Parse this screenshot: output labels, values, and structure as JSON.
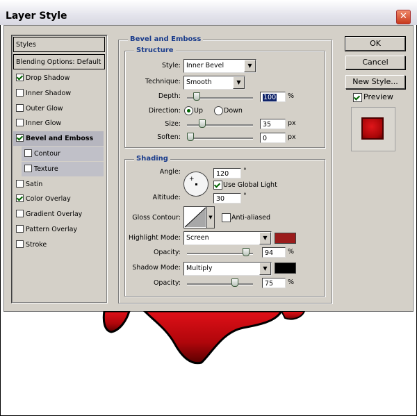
{
  "window": {
    "title": "Layer Style",
    "close_glyph": "✕"
  },
  "styles_list": {
    "header": "Styles",
    "blending": "Blending Options: Default",
    "items": [
      {
        "label": "Drop Shadow",
        "checked": true
      },
      {
        "label": "Inner Shadow",
        "checked": false
      },
      {
        "label": "Outer Glow",
        "checked": false
      },
      {
        "label": "Inner Glow",
        "checked": false
      },
      {
        "label": "Bevel and Emboss",
        "checked": true,
        "active": true
      },
      {
        "label": "Contour",
        "checked": false,
        "sub": true
      },
      {
        "label": "Texture",
        "checked": false,
        "sub": true
      },
      {
        "label": "Satin",
        "checked": false
      },
      {
        "label": "Color Overlay",
        "checked": true
      },
      {
        "label": "Gradient Overlay",
        "checked": false
      },
      {
        "label": "Pattern Overlay",
        "checked": false
      },
      {
        "label": "Stroke",
        "checked": false
      }
    ]
  },
  "bevel": {
    "title": "Bevel and Emboss",
    "structure": {
      "title": "Structure",
      "style_label": "Style:",
      "style_value": "Inner Bevel",
      "technique_label": "Technique:",
      "technique_value": "Smooth",
      "depth_label": "Depth:",
      "depth_value": "100",
      "depth_unit": "%",
      "depth_slider": 0.1,
      "direction_label": "Direction:",
      "direction_up": "Up",
      "direction_down": "Down",
      "direction_selected": "Up",
      "size_label": "Size:",
      "size_value": "35",
      "size_unit": "px",
      "size_slider": 0.2,
      "soften_label": "Soften:",
      "soften_value": "0",
      "soften_unit": "px",
      "soften_slider": 0.0
    },
    "shading": {
      "title": "Shading",
      "angle_label": "Angle:",
      "angle_value": "120",
      "angle_unit": "°",
      "global_light_label": "Use Global Light",
      "global_light": true,
      "altitude_label": "Altitude:",
      "altitude_value": "30",
      "altitude_unit": "°",
      "gloss_label": "Gloss Contour:",
      "anti_aliased_label": "Anti-aliased",
      "anti_aliased": false,
      "highlight_label": "Highlight Mode:",
      "highlight_value": "Screen",
      "highlight_color": "#9b1c1c",
      "hl_opacity_label": "Opacity:",
      "hl_opacity_value": "94",
      "hl_opacity_unit": "%",
      "hl_opacity_slider": 0.94,
      "shadow_label": "Shadow Mode:",
      "shadow_value": "Multiply",
      "shadow_color": "#000000",
      "sh_opacity_label": "Opacity:",
      "sh_opacity_value": "75",
      "sh_opacity_unit": "%",
      "sh_opacity_slider": 0.75
    }
  },
  "buttons": {
    "ok": "OK",
    "cancel": "Cancel",
    "new_style": "New Style...",
    "preview_label": "Preview",
    "preview_checked": true
  },
  "colors": {
    "accent_heading": "#1a3c8c",
    "artwork_red": "#c40a10"
  }
}
